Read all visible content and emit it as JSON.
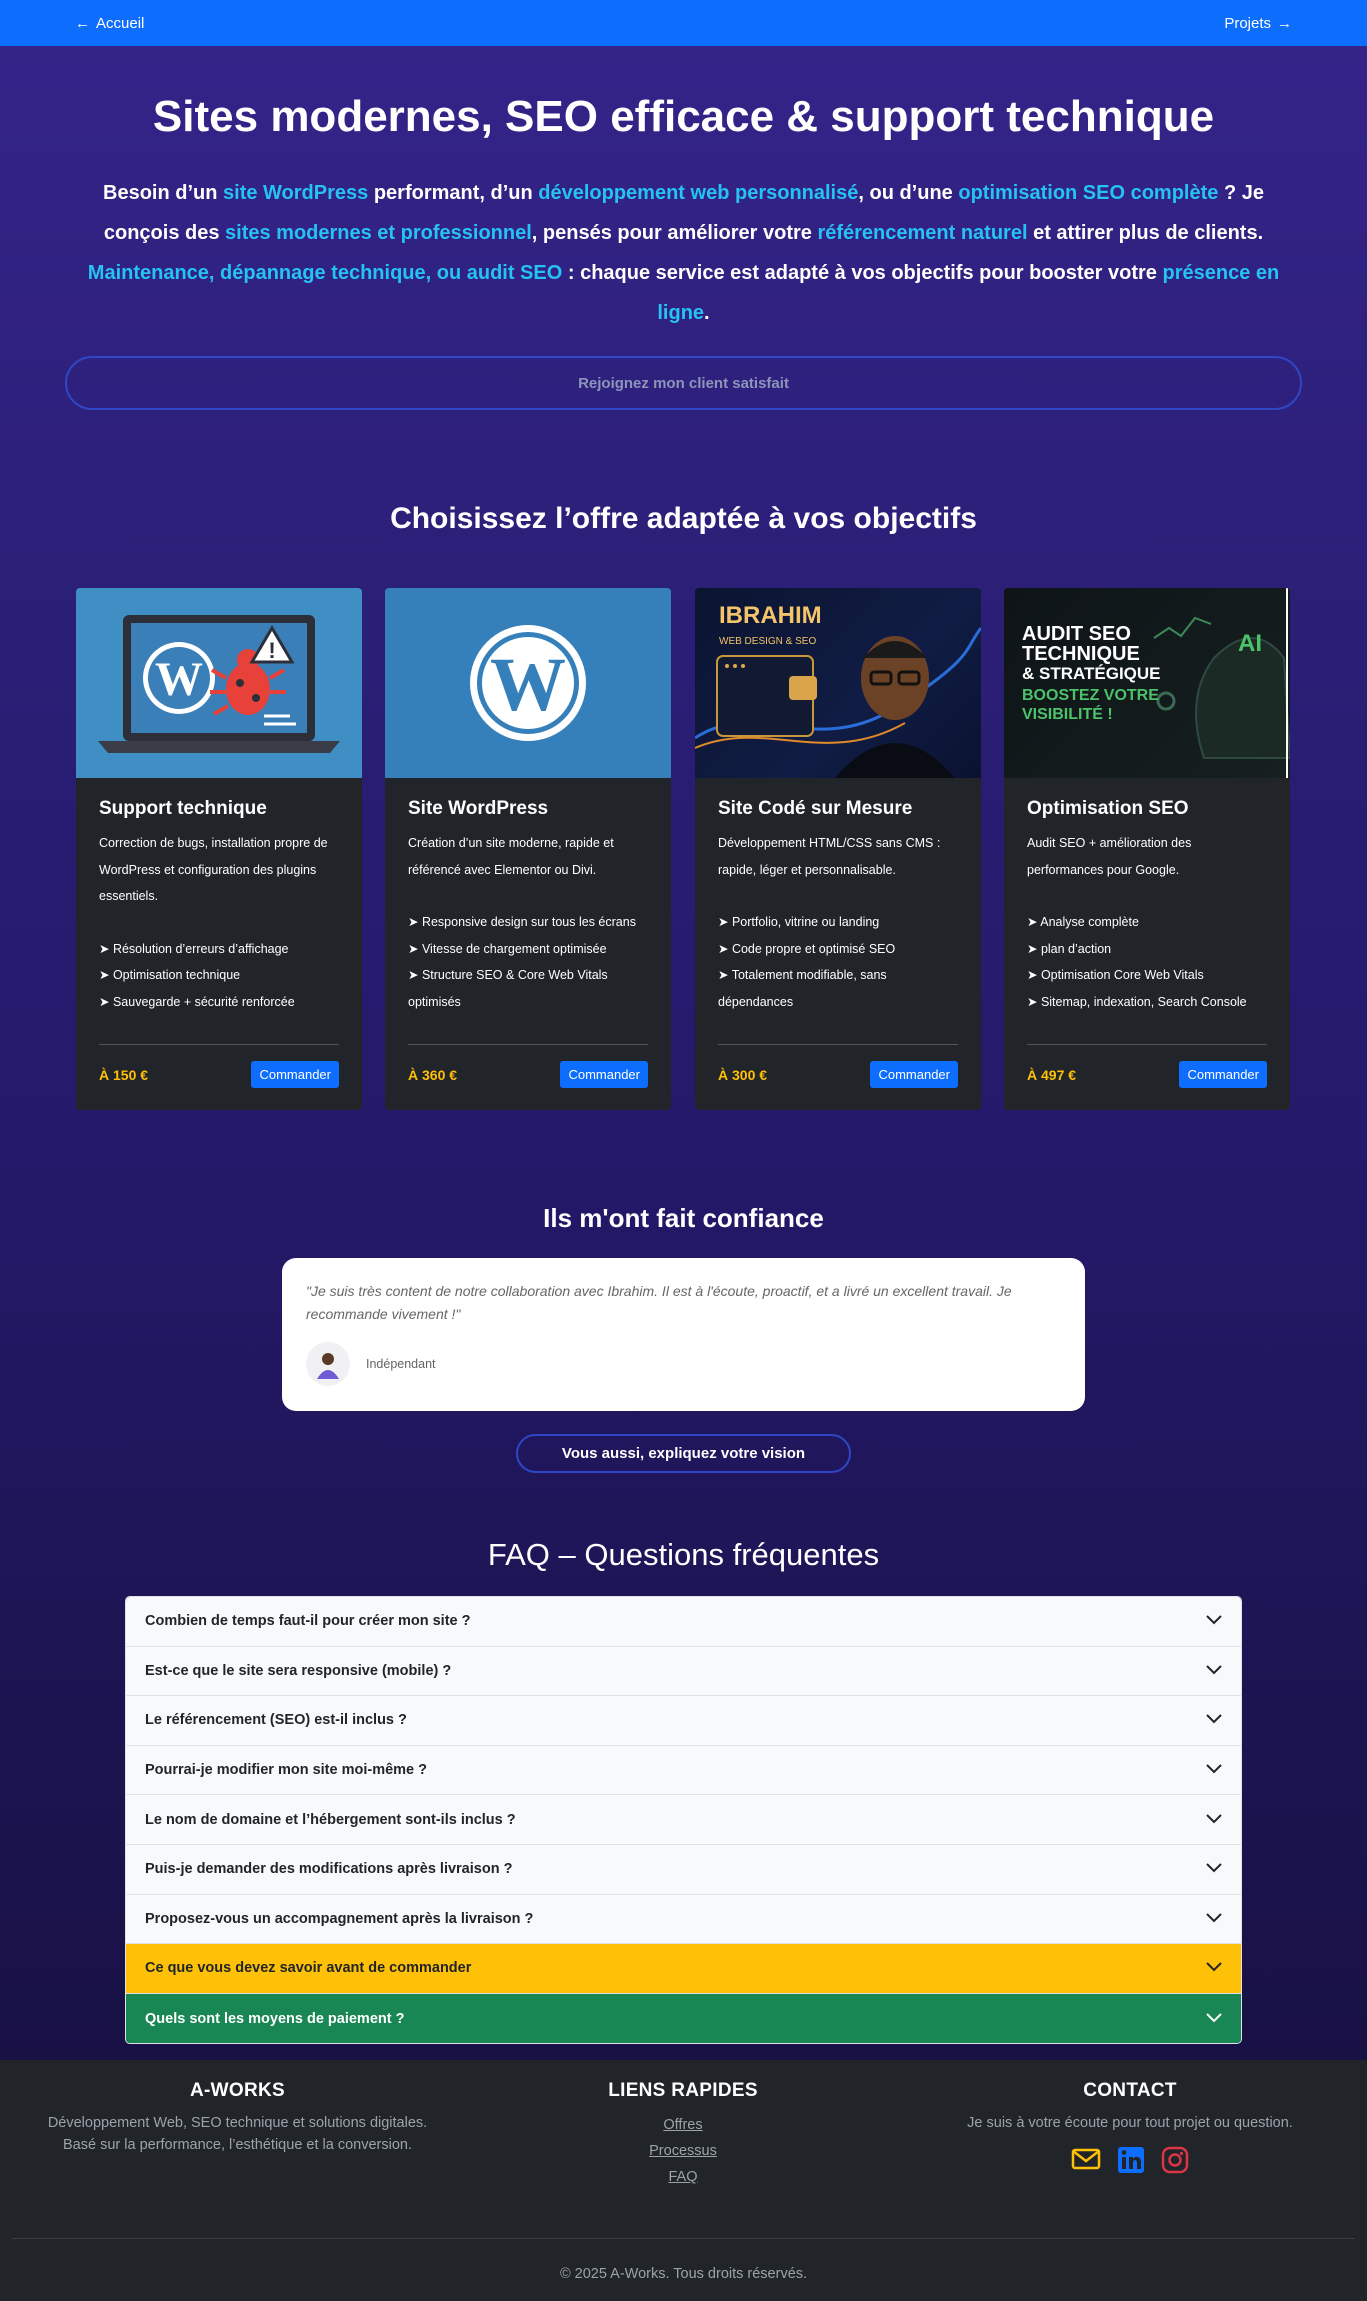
{
  "nav": {
    "back_label": "Accueil",
    "next_label": "Projets"
  },
  "hero": {
    "title": "Sites modernes, SEO efficace & support technique",
    "intro": [
      {
        "t": "Besoin d’un ",
        "h": false
      },
      {
        "t": "site WordPress",
        "h": true
      },
      {
        "t": " performant, d’un ",
        "h": false
      },
      {
        "t": "développement web personnalisé",
        "h": true
      },
      {
        "t": ", ou d’une ",
        "h": false
      },
      {
        "t": "optimisation SEO complète",
        "h": true
      },
      {
        "t": " ? Je conçois des ",
        "h": false
      },
      {
        "t": "sites modernes et professionnel",
        "h": true
      },
      {
        "t": ", pensés pour améliorer votre ",
        "h": false
      },
      {
        "t": "référencement naturel",
        "h": true
      },
      {
        "t": " et attirer plus de clients. ",
        "h": false
      },
      {
        "t": "Maintenance, dépannage technique, ou audit SEO",
        "h": true
      },
      {
        "t": " : chaque service est adapté à vos objectifs pour booster votre ",
        "h": false
      },
      {
        "t": "présence en ligne",
        "h": true
      },
      {
        "t": ".",
        "h": false
      }
    ],
    "join_label": "Rejoignez mon client satisfait"
  },
  "offers": {
    "title": "Choisissez l’offre adaptée à vos objectifs",
    "cards": [
      {
        "title": "Support technique",
        "desc": "Correction de bugs, installation propre de WordPress et configuration des plugins essentiels.",
        "features": [
          "➤ Résolution d’erreurs d’affichage",
          "➤ Optimisation technique",
          "➤ Sauvegarde + sécurité renforcée"
        ],
        "price": "À 150 €",
        "cta": "Commander"
      },
      {
        "title": "Site WordPress",
        "desc": "Création d’un site moderne, rapide et référencé avec Elementor ou Divi.",
        "features": [
          "➤ Responsive design sur tous les écrans",
          "➤ Vitesse de chargement optimisée",
          "➤ Structure SEO & Core Web Vitals optimisés"
        ],
        "price": "À 360 €",
        "cta": "Commander"
      },
      {
        "title": "Site Codé sur Mesure",
        "desc": "Développement HTML/CSS sans CMS : rapide, léger et personnalisable.",
        "features": [
          "➤ Portfolio, vitrine ou landing",
          "➤ Code propre et optimisé SEO",
          "➤ Totalement modifiable, sans dépendances"
        ],
        "price": "À 300 €",
        "cta": "Commander",
        "img": {
          "name": "IBRAHIM",
          "sub": "WEB DESIGN & SEO"
        }
      },
      {
        "title": "Optimisation SEO",
        "desc": "Audit SEO + amélioration des performances pour Google.",
        "features": [
          "➤ Analyse complète",
          "➤ plan d’action",
          "➤ Optimisation Core Web Vitals",
          "➤ Sitemap, indexation, Search Console"
        ],
        "price": "À 497 €",
        "cta": "Commander",
        "img": {
          "l1": "AUDIT SEO",
          "l2": "TECHNIQUE",
          "l3": "& STRATÉGIQUE",
          "l4": "BOOSTEZ VOTRE",
          "l5": "VISIBILITÉ !",
          "ai": "AI"
        }
      }
    ]
  },
  "trust": {
    "title": "Ils m'ont fait confiance",
    "quote": "\"Je suis très content de notre collaboration avec Ibrahim. Il est à l'écoute, proactif, et a livré un excellent travail. Je recommande vivement !\"",
    "author": "Indépendant",
    "cta": "Vous aussi, expliquez votre vision"
  },
  "faq": {
    "title": "FAQ – Questions fréquentes",
    "items": [
      "Combien de temps faut-il pour créer mon site ?",
      "Est-ce que le site sera responsive (mobile) ?",
      "Le référencement (SEO) est-il inclus ?",
      "Pourrai-je modifier mon site moi-même ?",
      "Le nom de domaine et l’hébergement sont-ils inclus ?",
      "Puis-je demander des modifications après livraison ?",
      "Proposez-vous un accompagnement après la livraison ?",
      "Ce que vous devez savoir avant de commander",
      "Quels sont les moyens de paiement ?"
    ]
  },
  "footer": {
    "brand": "A-WORKS",
    "brand_line1": "Développement Web, SEO technique et solutions digitales.",
    "brand_line2": "Basé sur la performance, l’esthétique et la conversion.",
    "links_title": "LIENS RAPIDES",
    "links": [
      "Offres",
      "Processus",
      "FAQ"
    ],
    "contact_title": "CONTACT",
    "contact_text": "Je suis à votre écoute pour tout projet ou question.",
    "copyright": "© 2025 A-Works. Tous droits réservés."
  },
  "colors": {
    "accent": "#25c2f3",
    "primary": "#0d6efd",
    "price": "#ffc107",
    "success": "#198754"
  }
}
